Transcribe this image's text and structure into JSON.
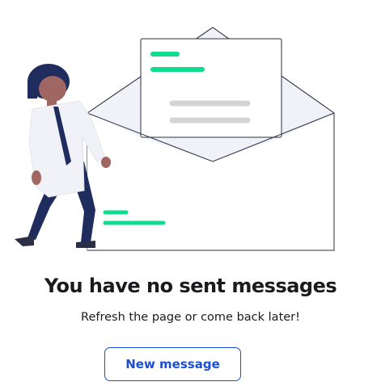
{
  "empty_state": {
    "illustration_icon": "envelope-illustration",
    "heading": "You have no sent messages",
    "subtext": "Refresh the page or come back later!",
    "button_label": "New message"
  },
  "colors": {
    "accent": "#1a4fd1",
    "green_line": "#0fdc8f",
    "navy": "#1f2c5e",
    "grey_line": "#d4d4d4",
    "envelope_fill": "#f1f1f8",
    "skin": "#a06661",
    "hair": "#1f2c5e"
  }
}
